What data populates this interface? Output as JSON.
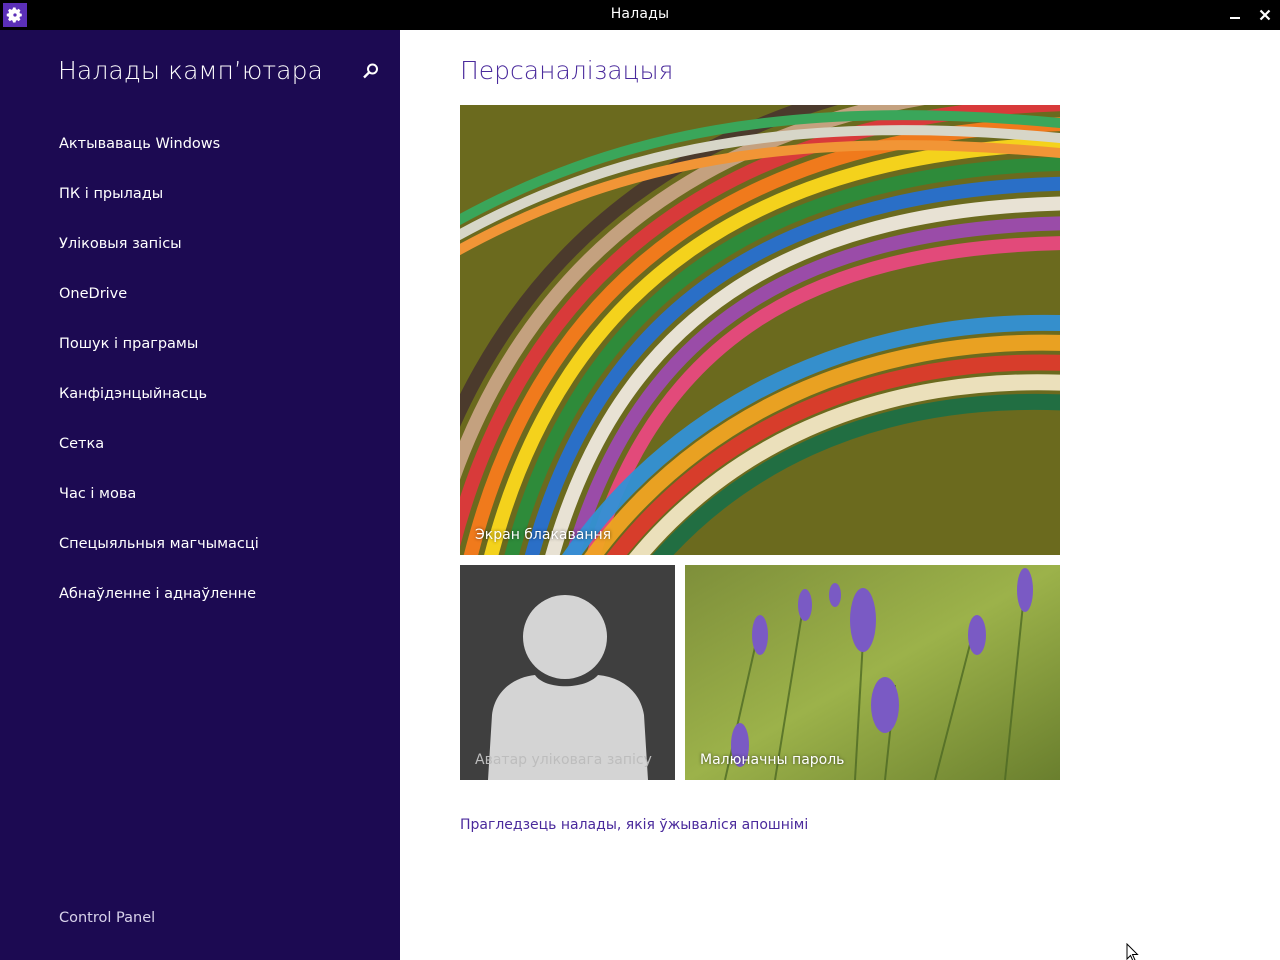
{
  "window": {
    "title": "Налады",
    "app_icon": "gear-icon",
    "minimize_icon": "minimize-icon",
    "close_icon": "close-icon"
  },
  "sidebar": {
    "title": "Налады камп’ютара",
    "search_icon": "search-icon",
    "items": [
      {
        "label": "Актываваць Windows"
      },
      {
        "label": "ПК і прылады"
      },
      {
        "label": "Уліковыя запісы"
      },
      {
        "label": "OneDrive"
      },
      {
        "label": "Пошук і праграмы"
      },
      {
        "label": "Канфідэнцыйнасць"
      },
      {
        "label": "Сетка"
      },
      {
        "label": "Час і мова"
      },
      {
        "label": "Спецыяльныя магчымасці"
      },
      {
        "label": "Абнаўленне і аднаўленне"
      }
    ],
    "control_panel": "Control Panel"
  },
  "main": {
    "title": "Персаналізацыя",
    "tiles": {
      "lock_screen": "Экран блакавання",
      "account_picture": "Аватар уліковага запісу",
      "picture_password": "Малюначны пароль"
    },
    "recent_link": "Прагледзець налады, якія ўжываліся апошнімі"
  },
  "colors": {
    "titlebar": "#000000",
    "sidebar_bg": "#1c0a52",
    "accent": "#4a2a9c",
    "app_icon_bg": "#5b2fb8"
  }
}
